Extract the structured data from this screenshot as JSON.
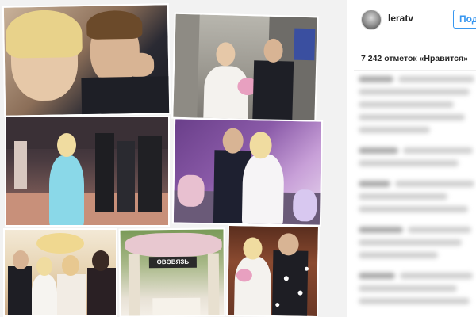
{
  "post": {
    "username": "leratv",
    "follow_label": "Под",
    "likes_text": "7 242 отметок «Нравится»"
  },
  "collage": {
    "caption_sign": "ΘΒΘΒЯЗЬ"
  },
  "colors": {
    "accent": "#3897f0",
    "text": "#262626",
    "divider": "#efefef"
  }
}
